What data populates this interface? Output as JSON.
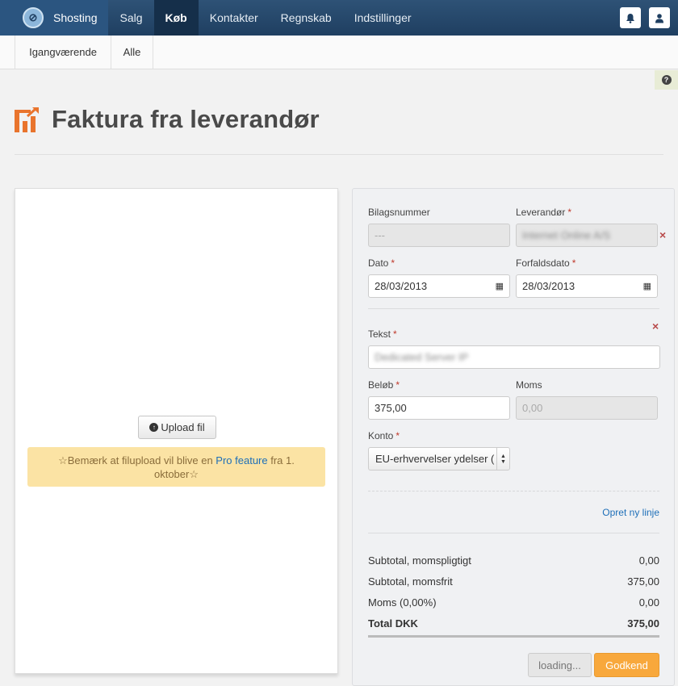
{
  "nav": {
    "brand": "Shosting",
    "items": [
      {
        "label": "Salg"
      },
      {
        "label": "Køb"
      },
      {
        "label": "Kontakter"
      },
      {
        "label": "Regnskab"
      },
      {
        "label": "Indstillinger"
      }
    ],
    "active_item": "Køb",
    "right_icons": [
      "bell-icon",
      "user-icon"
    ]
  },
  "subnav": {
    "tabs": [
      {
        "label": "Igangværende"
      },
      {
        "label": "Alle"
      }
    ]
  },
  "help_icon": "?",
  "page": {
    "title": "Faktura fra leverandør"
  },
  "upload": {
    "button_label": "Upload fil",
    "notice_before": "☆Bemærk at filupload vil blive en ",
    "notice_link": "Pro feature",
    "notice_after": " fra 1. oktober☆"
  },
  "form": {
    "bilagsnummer_label": "Bilagsnummer",
    "bilagsnummer_value": "---",
    "leverandor_label": "Leverandør",
    "leverandor_value": "Internet Online A/S",
    "dato_label": "Dato",
    "dato_value": "28/03/2013",
    "forfaldsdato_label": "Forfaldsdato",
    "forfaldsdato_value": "28/03/2013",
    "tekst_label": "Tekst",
    "tekst_value": "Dedicated Server IP",
    "belob_label": "Beløb",
    "belob_value": "375,00",
    "moms_label": "Moms",
    "moms_value": "0,00",
    "konto_label": "Konto",
    "konto_value": "EU-erhvervelser ydelser (",
    "required_mark": "*",
    "remove_mark": "×",
    "new_line_link": "Opret ny linje"
  },
  "summary": {
    "rows": [
      {
        "label": "Subtotal, momspligtigt",
        "value": "0,00"
      },
      {
        "label": "Subtotal, momsfrit",
        "value": "375,00"
      },
      {
        "label": "Moms (0,00%)",
        "value": "0,00"
      }
    ],
    "total_label": "Total DKK",
    "total_value": "375,00"
  },
  "actions": {
    "loading_label": "loading...",
    "approve_label": "Godkend"
  },
  "colors": {
    "nav_bg": "#1f3f61",
    "accent_orange": "#f8a83c",
    "link_blue": "#1e6fb8",
    "notice_bg": "#fbe3a4"
  }
}
